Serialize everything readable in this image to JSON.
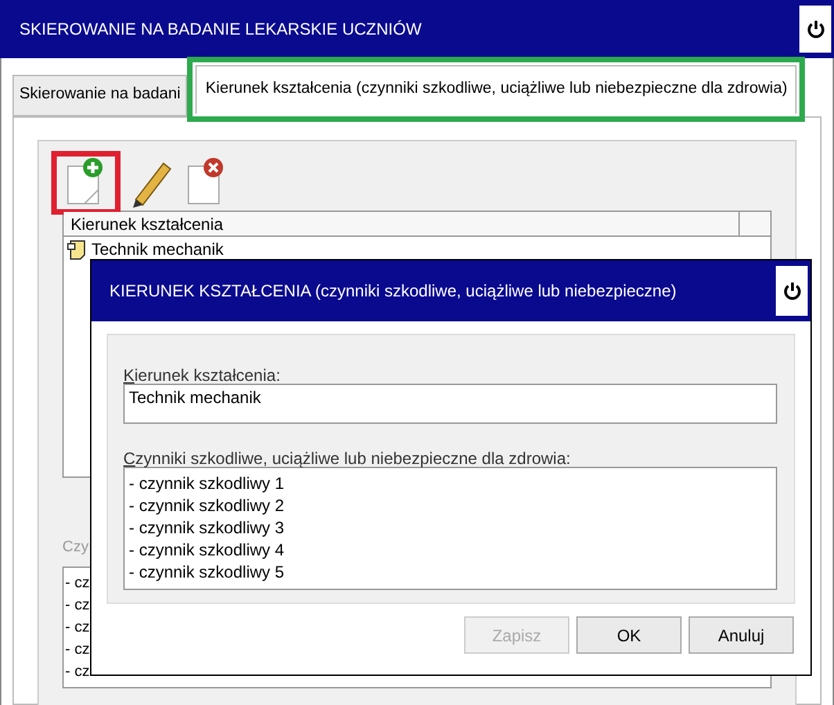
{
  "main_window": {
    "title": "SKIEROWANIE NA BADANIE LEKARSKIE UCZNIÓW",
    "tabs": [
      {
        "label": "Skierowanie na badani",
        "selected": false,
        "highlighted": false
      },
      {
        "label": "Kierunek kształcenia (czynniki szkodliwe, uciążliwe lub niebezpieczne dla zdrowia)",
        "selected": true,
        "highlighted": true
      }
    ],
    "toolbar": [
      {
        "kind": "add",
        "highlighted": true
      },
      {
        "kind": "edit",
        "highlighted": false
      },
      {
        "kind": "delete",
        "highlighted": false
      }
    ],
    "table": {
      "columns": [
        "Kierunek kształcenia"
      ],
      "rows": [
        "Technik mechanik"
      ]
    },
    "factors_label": "Czy",
    "factors": [
      "- cz",
      "- cz",
      "- cz",
      "- cz",
      "- cz"
    ]
  },
  "dialog": {
    "title": "KIERUNEK KSZTAŁCENIA (czynniki szkodliwe, uciążliwe lub niebezpieczne)",
    "field_label": "Kierunek kształcenia:",
    "field_value": "Technik mechanik",
    "factors_label": "Czynniki szkodliwe, uciążliwe lub niebezpieczne dla zdrowia:",
    "factors": [
      "- czynnik szkodliwy 1",
      "- czynnik szkodliwy 2",
      "- czynnik szkodliwy 3",
      "- czynnik szkodliwy 4",
      "- czynnik szkodliwy 5"
    ],
    "buttons": [
      {
        "label": "Zapisz",
        "disabled": true
      },
      {
        "label": "OK",
        "disabled": false
      },
      {
        "label": "Anuluj",
        "disabled": false
      }
    ]
  }
}
